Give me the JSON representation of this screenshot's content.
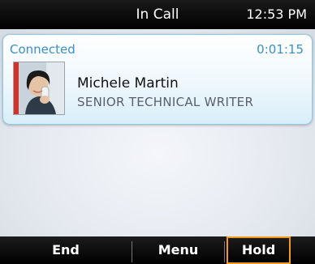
{
  "status_bar": {
    "title": "In Call",
    "time": "12:53 PM"
  },
  "call": {
    "status": "Connected",
    "duration": "0:01:15",
    "contact_name": "Michele Martin",
    "contact_title": "SENIOR TECHNICAL WRITER",
    "presence_color": "#d6302b"
  },
  "softkeys": [
    {
      "label": "End"
    },
    {
      "label": "Menu"
    },
    {
      "label": "Hold",
      "selected": true
    }
  ],
  "colors": {
    "accent": "#3a8fc7",
    "selection": "#f29a1f"
  }
}
